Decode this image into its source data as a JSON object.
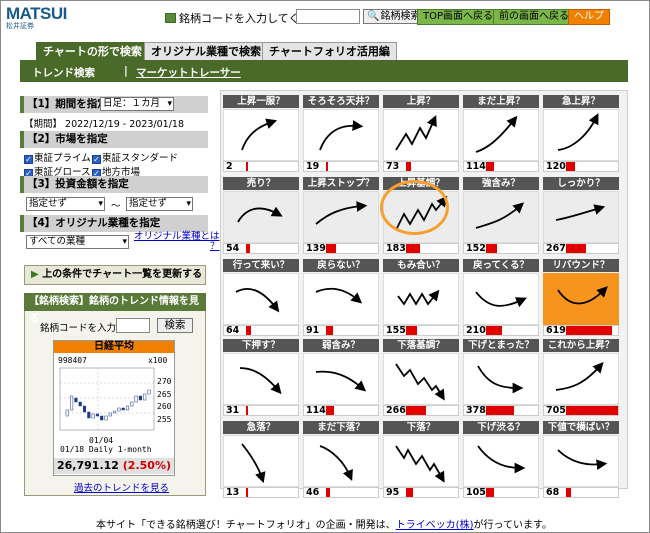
{
  "header": {
    "logo_text": "MATSUI",
    "logo_sub": "松井証券",
    "code_prompt": "銘柄コードを入力してください",
    "search_label": "銘柄検索",
    "btn_top": "TOP画面へ戻る",
    "btn_prev": "前の画面へ戻る",
    "btn_help": "ヘルプ"
  },
  "tabs": [
    {
      "label": "チャートの形で検索"
    },
    {
      "label": "オリジナル業種で検索"
    },
    {
      "label": "チャートフォリオ活用編"
    }
  ],
  "subnav": {
    "item1": "トレンド検索",
    "sep": "|",
    "item2": "マーケットトレーサー"
  },
  "left": {
    "s1": "【1】期間を指定",
    "period_select": "日足：１カ月",
    "period_text": "【期間】 2022/12/19 - 2023/01/18",
    "s2": "【2】市場を指定",
    "markets": [
      "東証プライム",
      "東証スタンダード",
      "東証グロース",
      "地方市場"
    ],
    "s3": "【3】投資金額を指定",
    "amount_from": "指定せず",
    "tilde": "〜",
    "amount_to": "指定せず",
    "s4": "【4】オリジナル業種を指定",
    "industry_select": "すべての業種",
    "industry_link1": "オリジナル業種とは",
    "industry_link2": "？",
    "update_btn": "上の条件でチャート一覧を更新する",
    "trend_head": "【銘柄検索】銘柄のトレンド情報を見る",
    "code_label": "銘柄コードを入力",
    "code_btn": "検索",
    "nikkei_title": "日経平均",
    "nikkei_code": "998407",
    "nikkei_unit": "x100",
    "nikkei_ticks": [
      "270",
      "265",
      "260",
      "255"
    ],
    "nikkei_date": "01/04",
    "nikkei_caption": "01/18 Daily 1-month",
    "nikkei_price": "26,791.12",
    "nikkei_change": "(2.50%)",
    "past_trend_link": "過去のトレンドを見る"
  },
  "patterns": [
    {
      "label": "上昇一服？",
      "count": "2",
      "bar": 0.01
    },
    {
      "label": "そろそろ天井？",
      "count": "19",
      "bar": 0.03
    },
    {
      "label": "上昇？",
      "count": "73",
      "bar": 0.1
    },
    {
      "label": "まだ上昇？",
      "count": "114",
      "bar": 0.16
    },
    {
      "label": "急上昇？",
      "count": "120",
      "bar": 0.17
    },
    {
      "label": "売り？",
      "count": "54",
      "bar": 0.08
    },
    {
      "label": "上昇ストップ？",
      "count": "139",
      "bar": 0.2
    },
    {
      "label": "上昇基調？",
      "count": "183",
      "bar": 0.26
    },
    {
      "label": "強含み？",
      "count": "152",
      "bar": 0.22
    },
    {
      "label": "しっかり？",
      "count": "267",
      "bar": 0.38
    },
    {
      "label": "行って来い？",
      "count": "64",
      "bar": 0.09
    },
    {
      "label": "戻らない？",
      "count": "91",
      "bar": 0.13
    },
    {
      "label": "もみ合い？",
      "count": "155",
      "bar": 0.22
    },
    {
      "label": "戻ってくる？",
      "count": "210",
      "bar": 0.3
    },
    {
      "label": "リバウンド？",
      "count": "619",
      "bar": 0.88
    },
    {
      "label": "下押す？",
      "count": "31",
      "bar": 0.04
    },
    {
      "label": "弱含み？",
      "count": "114",
      "bar": 0.16
    },
    {
      "label": "下落基調？",
      "count": "266",
      "bar": 0.38
    },
    {
      "label": "下げとまった？",
      "count": "378",
      "bar": 0.54
    },
    {
      "label": "これから上昇？",
      "count": "705",
      "bar": 1.0
    },
    {
      "label": "急落？",
      "count": "13",
      "bar": 0.02
    },
    {
      "label": "まだ下落？",
      "count": "46",
      "bar": 0.07
    },
    {
      "label": "下落？",
      "count": "95",
      "bar": 0.13
    },
    {
      "label": "下げ渋る？",
      "count": "105",
      "bar": 0.15
    },
    {
      "label": "下値で横ばい？",
      "count": "68",
      "bar": 0.1
    }
  ],
  "footer": {
    "text1": "本サイト「できる銘柄選び！チャートフォリオ」の企画・開発は、",
    "link": "トライベッカ(株)",
    "text2": "が行っています。"
  },
  "colors": {
    "accent_green": "#4a6a2a",
    "highlight_orange": "#f7941d",
    "bar_red": "#e00000"
  }
}
